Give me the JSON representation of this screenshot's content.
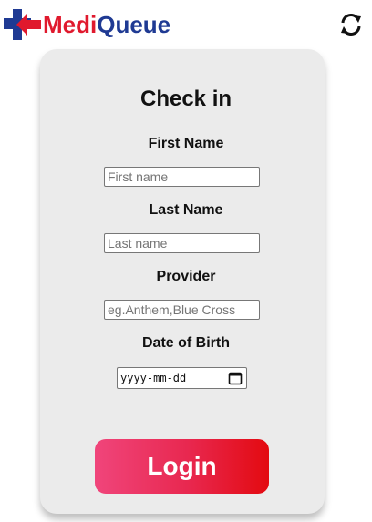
{
  "header": {
    "brand_part1": "Medi",
    "brand_part2": "Queue",
    "refresh_icon": "refresh-icon",
    "colors": {
      "brand_red": "#e0192d",
      "brand_blue": "#1f3a93"
    }
  },
  "form": {
    "title": "Check in",
    "first_name": {
      "label": "First Name",
      "placeholder": "First name",
      "value": ""
    },
    "last_name": {
      "label": "Last Name",
      "placeholder": "Last name",
      "value": ""
    },
    "provider": {
      "label": "Provider",
      "placeholder": "eg.Anthem,Blue Cross",
      "value": ""
    },
    "dob": {
      "label": "Date of Birth",
      "placeholder": "yyyy-mm-dd",
      "icon": "calendar-icon"
    },
    "login_label": "Login",
    "colors": {
      "card_bg": "#ebebeb",
      "button_start": "#f0457b",
      "button_end": "#e30a10"
    }
  }
}
